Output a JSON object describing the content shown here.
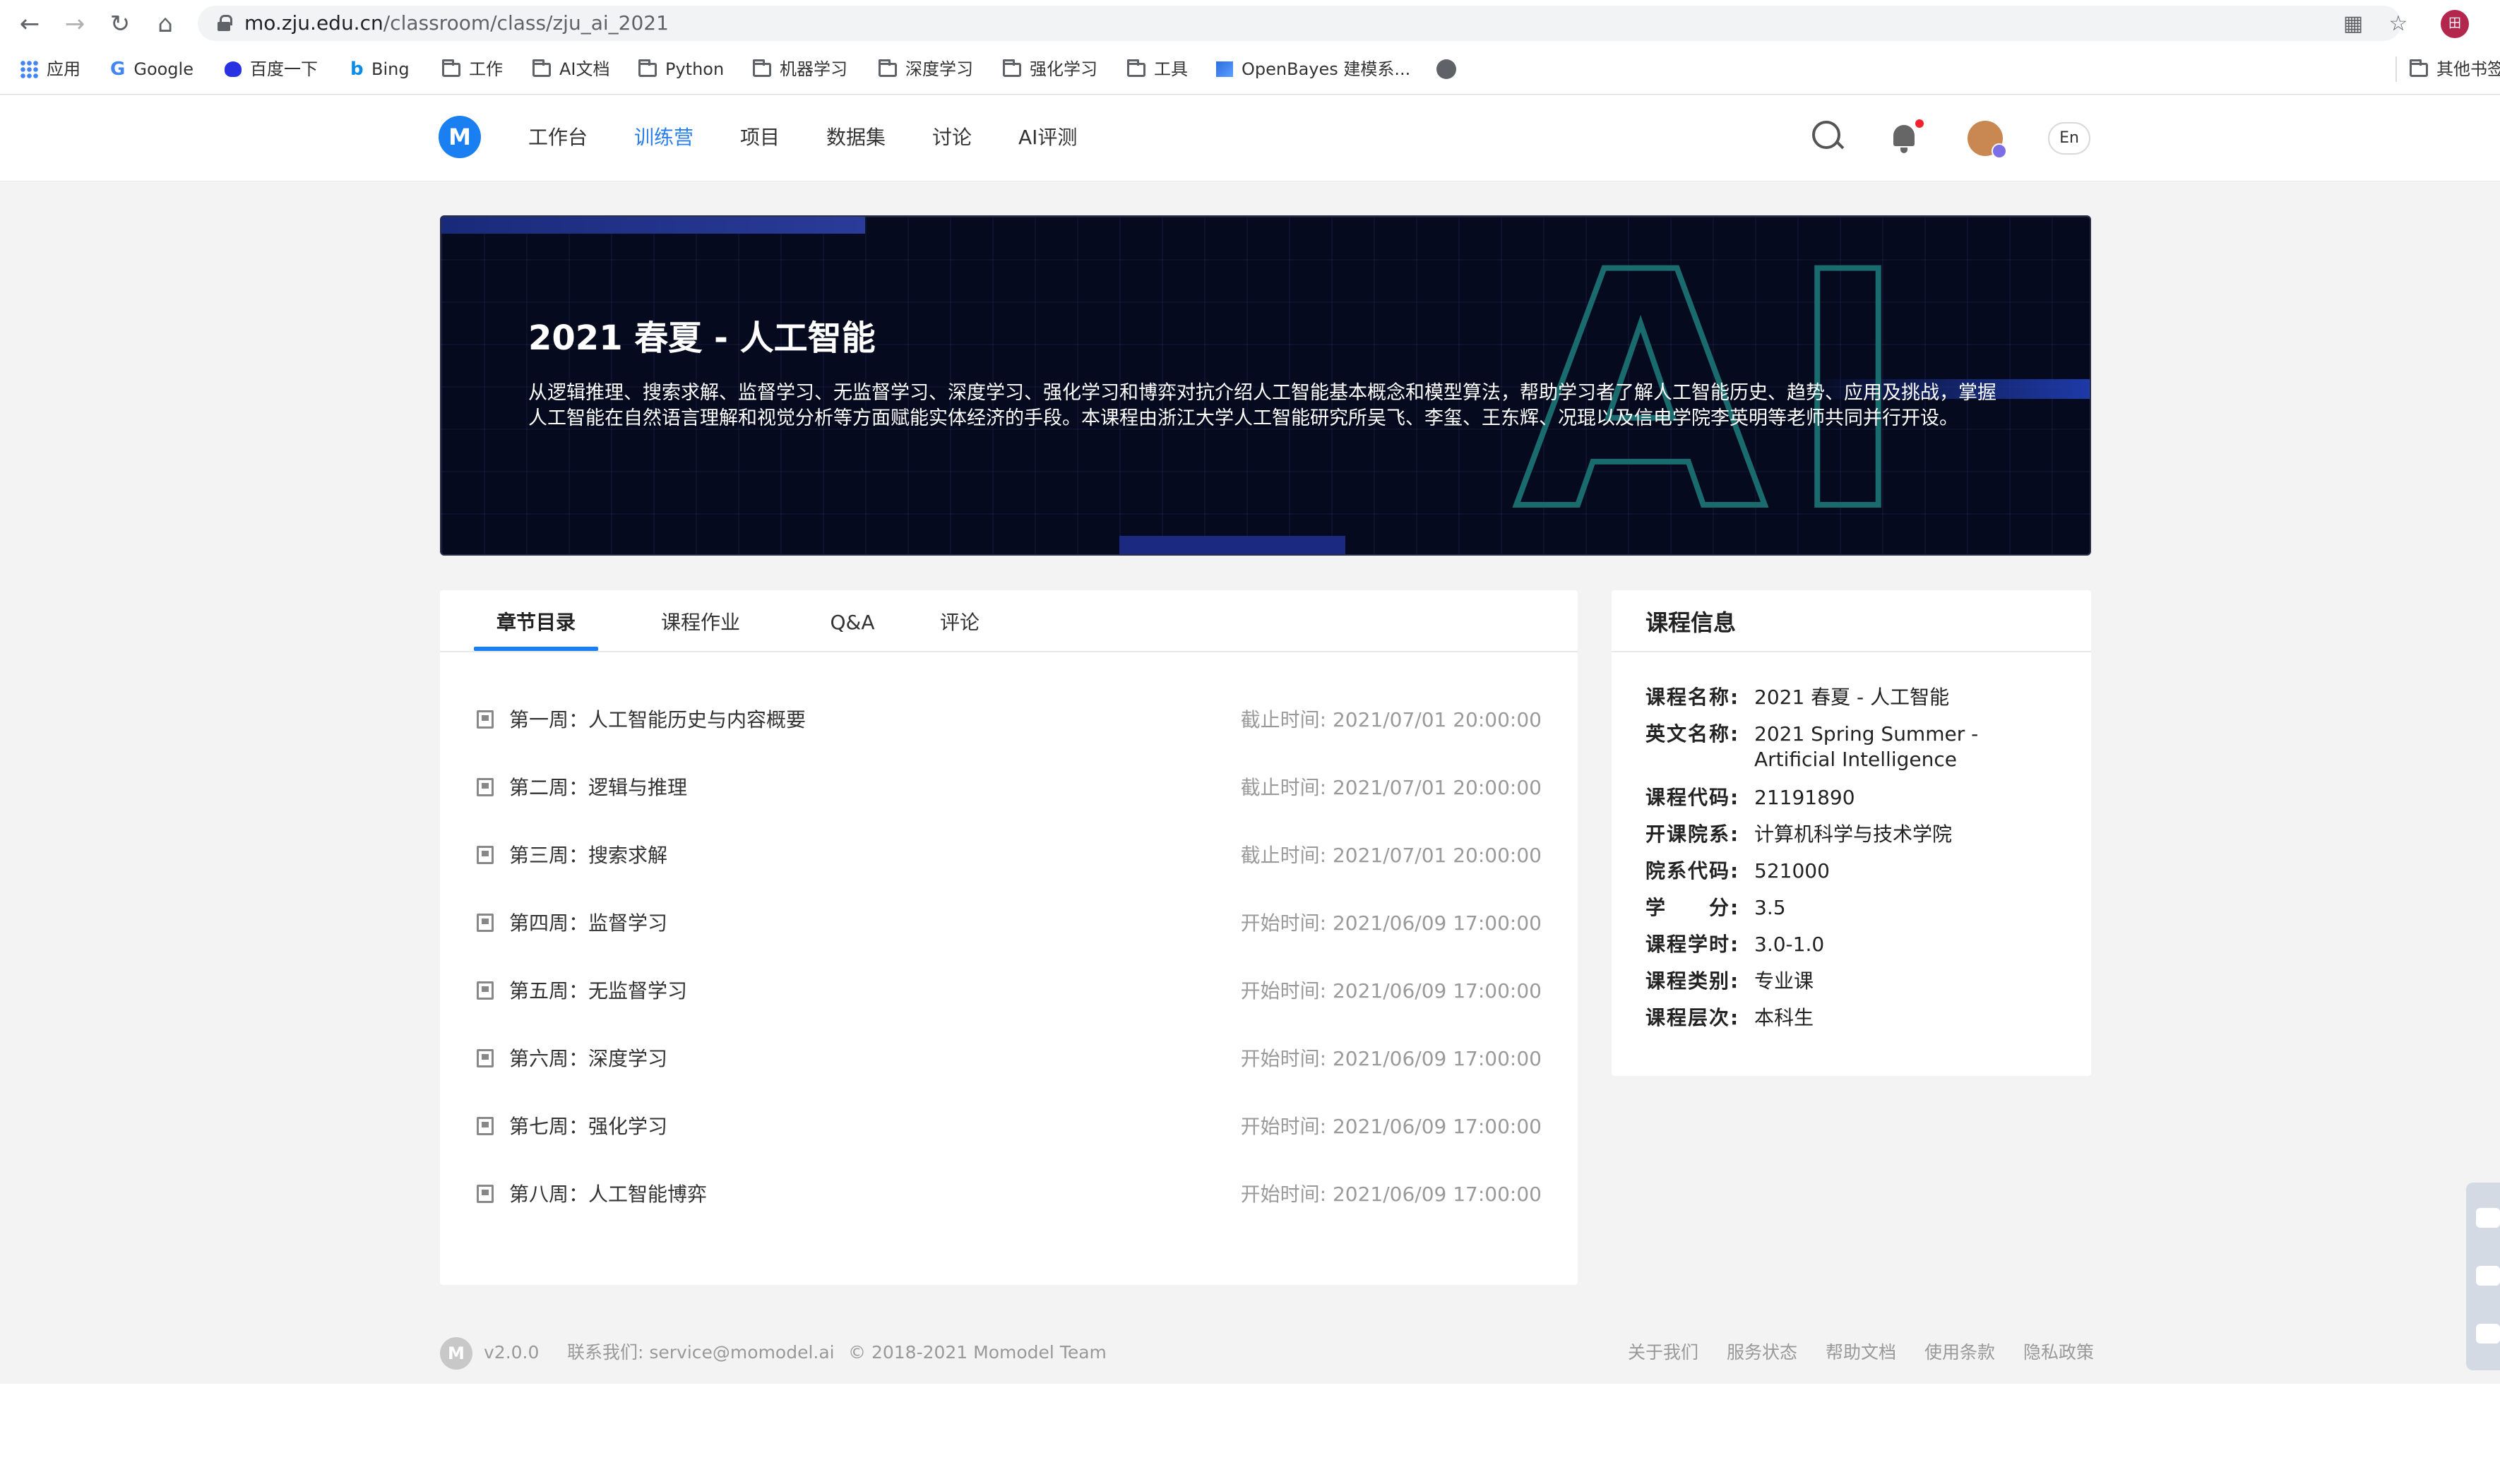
{
  "browser": {
    "url_host": "mo.zju.edu.cn",
    "url_path": "/classroom/class/zju_ai_2021",
    "profile_initial": "田",
    "bookmarks": [
      {
        "label": "应用",
        "icon": "apps-grid-icon"
      },
      {
        "label": "Google",
        "icon": "google-icon"
      },
      {
        "label": "百度一下",
        "icon": "baidu-icon"
      },
      {
        "label": "Bing",
        "icon": "bing-icon"
      },
      {
        "label": "工作",
        "icon": "folder-icon"
      },
      {
        "label": "AI文档",
        "icon": "folder-icon"
      },
      {
        "label": "Python",
        "icon": "folder-icon"
      },
      {
        "label": "机器学习",
        "icon": "folder-icon"
      },
      {
        "label": "深度学习",
        "icon": "folder-icon"
      },
      {
        "label": "强化学习",
        "icon": "folder-icon"
      },
      {
        "label": "工具",
        "icon": "folder-icon"
      },
      {
        "label": "OpenBayes 建模系...",
        "icon": "openbayes-icon"
      }
    ],
    "other_bookmarks": "其他书签"
  },
  "header": {
    "logo": "M",
    "nav": [
      "工作台",
      "训练营",
      "项目",
      "数据集",
      "讨论",
      "AI评测"
    ],
    "active_nav": "训练营",
    "lang": "En"
  },
  "banner": {
    "title": "2021 春夏 - 人工智能",
    "description": "从逻辑推理、搜索求解、监督学习、无监督学习、深度学习、强化学习和博弈对抗介绍人工智能基本概念和模型算法，帮助学习者了解人工智能历史、趋势、应用及挑战，掌握人工智能在自然语言理解和视觉分析等方面赋能实体经济的手段。本课程由浙江大学人工智能研究所吴飞、李玺、王东辉、况琨以及信电学院李英明等老师共同并行开设。",
    "art_text": "AI"
  },
  "tabs": [
    "章节目录",
    "课程作业",
    "Q&A",
    "评论"
  ],
  "chapters": [
    {
      "title": "第一周：人工智能历史与内容概要",
      "date": "截止时间: 2021/07/01 20:00:00"
    },
    {
      "title": "第二周：逻辑与推理",
      "date": "截止时间: 2021/07/01 20:00:00"
    },
    {
      "title": "第三周：搜索求解",
      "date": "截止时间: 2021/07/01 20:00:00"
    },
    {
      "title": "第四周：监督学习",
      "date": "开始时间: 2021/06/09 17:00:00"
    },
    {
      "title": "第五周：无监督学习",
      "date": "开始时间: 2021/06/09 17:00:00"
    },
    {
      "title": "第六周：深度学习",
      "date": "开始时间: 2021/06/09 17:00:00"
    },
    {
      "title": "第七周：强化学习",
      "date": "开始时间: 2021/06/09 17:00:00"
    },
    {
      "title": "第八周：人工智能博弈",
      "date": "开始时间: 2021/06/09 17:00:00"
    }
  ],
  "course_info": {
    "heading": "课程信息",
    "rows": [
      {
        "key": "课程名称:",
        "value": "2021 春夏 - 人工智能"
      },
      {
        "key": "英文名称:",
        "value": "2021 Spring Summer - Artificial Intelligence"
      },
      {
        "key": "课程代码:",
        "value": "21191890"
      },
      {
        "key": "开课院系:",
        "value": "计算机科学与技术学院"
      },
      {
        "key": "院系代码:",
        "value": "521000"
      },
      {
        "key": "学　　分:",
        "value": "3.5"
      },
      {
        "key": "课程学时:",
        "value": "3.0-1.0"
      },
      {
        "key": "课程类别:",
        "value": "专业课"
      },
      {
        "key": "课程层次:",
        "value": "本科生"
      }
    ]
  },
  "footer": {
    "version": "v2.0.0",
    "contact": "联系我们: service@momodel.ai",
    "copyright": "© 2018-2021 Momodel Team",
    "links": [
      "关于我们",
      "服务状态",
      "帮助文档",
      "使用条款",
      "隐私政策"
    ]
  }
}
